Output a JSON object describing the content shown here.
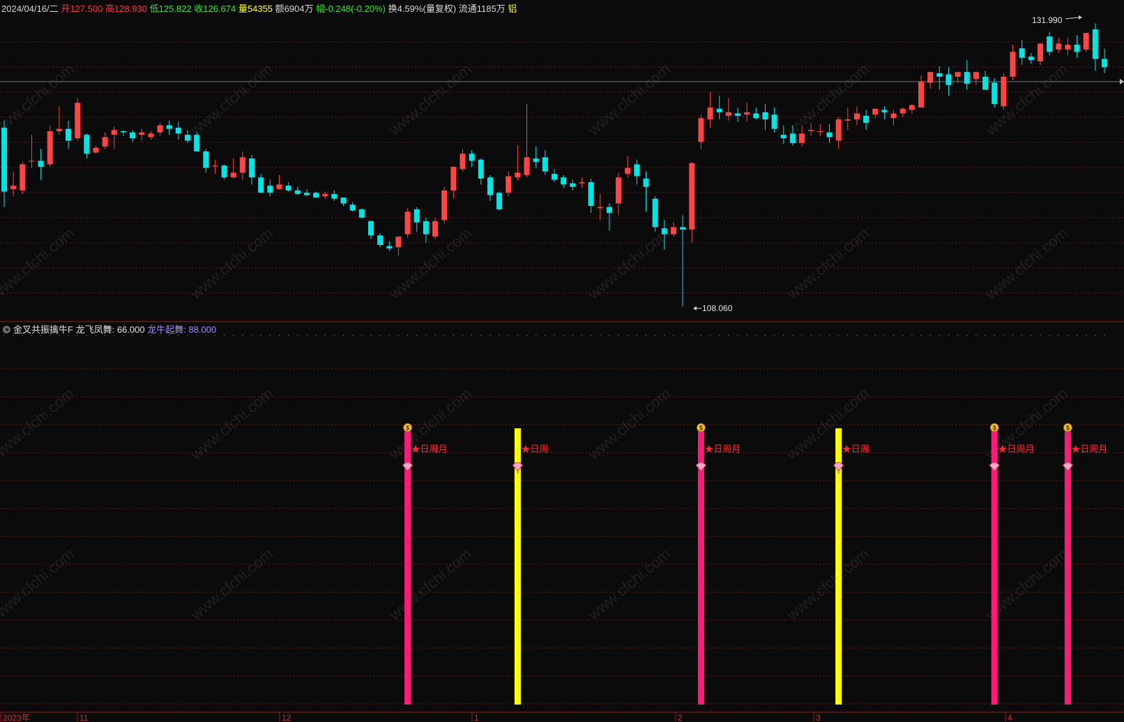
{
  "info_bar": {
    "date": "2024/04/16/二",
    "open": {
      "label": "开",
      "value": "127.500"
    },
    "high": {
      "label": "高",
      "value": "128.930"
    },
    "low": {
      "label": "低",
      "value": "125.822"
    },
    "close": {
      "label": "收",
      "value": "126.674"
    },
    "volume": {
      "label": "量",
      "value": "54355"
    },
    "amount": {
      "label": "额",
      "value": "6904万"
    },
    "change": {
      "label": "幅",
      "value": "-0.248(-0.20%)"
    },
    "turnover": {
      "label": "换",
      "value": "4.59%"
    },
    "adjust": "(量复权)",
    "float": {
      "label": "流通",
      "value": "1185万"
    },
    "sector": "铝"
  },
  "indicator_bar": {
    "name": "金叉共振擒牛F",
    "line1": {
      "label": "龙飞凤舞",
      "value": "66.000"
    },
    "line2": {
      "label": "龙牛起舞",
      "value": "88.000"
    }
  },
  "price_panel": {
    "high_marker": "131.990",
    "low_marker": "108.060",
    "ylim": [
      107.0,
      132.8
    ]
  },
  "time_axis": [
    "2023年",
    "11",
    "12",
    "1",
    "2",
    "3",
    "4"
  ],
  "watermark": "www.cfchi.com",
  "colors": {
    "up": "#ff4444",
    "down": "#00e5e5",
    "pink": "#ff1a7a",
    "yellow": "#ffff00",
    "bg": "#0b0b0b",
    "grid": "#6a1b1b",
    "signal_text": "#ff2a2a"
  },
  "chart_data": {
    "type": "candlestick",
    "series": [
      {
        "o": 123.2,
        "h": 123.8,
        "c": 117.8,
        "l": 116.5
      },
      {
        "o": 118.0,
        "h": 119.5,
        "c": 118.3,
        "l": 117.4
      },
      {
        "o": 117.9,
        "h": 120.3,
        "c": 120.1,
        "l": 117.6
      },
      {
        "o": 120.4,
        "h": 122.6,
        "c": 120.4,
        "l": 119.8
      },
      {
        "o": 120.4,
        "h": 121.4,
        "c": 119.9,
        "l": 118.8
      },
      {
        "o": 120.1,
        "h": 123.4,
        "c": 122.9,
        "l": 119.9
      },
      {
        "o": 122.9,
        "h": 125.0,
        "c": 123.1,
        "l": 122.6
      },
      {
        "o": 123.1,
        "h": 123.8,
        "c": 122.1,
        "l": 121.4
      },
      {
        "o": 122.3,
        "h": 125.7,
        "c": 125.3,
        "l": 122.1
      },
      {
        "o": 122.6,
        "h": 122.7,
        "c": 121.0,
        "l": 120.6
      },
      {
        "o": 121.1,
        "h": 121.7,
        "c": 121.5,
        "l": 121.0
      },
      {
        "o": 121.6,
        "h": 122.8,
        "c": 122.4,
        "l": 121.4
      },
      {
        "o": 122.6,
        "h": 123.3,
        "c": 123.0,
        "l": 121.4
      },
      {
        "o": 122.9,
        "h": 123.0,
        "c": 122.8,
        "l": 122.5
      },
      {
        "o": 122.8,
        "h": 123.0,
        "c": 122.3,
        "l": 122.0
      },
      {
        "o": 122.6,
        "h": 123.1,
        "c": 122.8,
        "l": 122.1
      },
      {
        "o": 122.4,
        "h": 122.9,
        "c": 122.7,
        "l": 122.2
      },
      {
        "o": 122.8,
        "h": 123.6,
        "c": 123.4,
        "l": 122.5
      },
      {
        "o": 123.4,
        "h": 123.8,
        "c": 123.1,
        "l": 122.6
      },
      {
        "o": 123.2,
        "h": 123.7,
        "c": 122.7,
        "l": 122.2
      },
      {
        "o": 122.6,
        "h": 123.0,
        "c": 122.1,
        "l": 121.9
      },
      {
        "o": 122.6,
        "h": 122.8,
        "c": 121.2,
        "l": 121.2
      },
      {
        "o": 121.2,
        "h": 121.4,
        "c": 119.8,
        "l": 119.4
      },
      {
        "o": 120.0,
        "h": 120.5,
        "c": 120.0,
        "l": 119.3
      },
      {
        "o": 120.0,
        "h": 120.1,
        "c": 119.0,
        "l": 118.8
      },
      {
        "o": 119.0,
        "h": 120.6,
        "c": 119.4,
        "l": 118.9
      },
      {
        "o": 119.4,
        "h": 121.2,
        "c": 120.7,
        "l": 118.8
      },
      {
        "o": 120.6,
        "h": 120.9,
        "c": 119.0,
        "l": 118.4
      },
      {
        "o": 119.0,
        "h": 119.3,
        "c": 117.7,
        "l": 117.7
      },
      {
        "o": 118.3,
        "h": 118.8,
        "c": 117.7,
        "l": 117.4
      },
      {
        "o": 118.0,
        "h": 119.2,
        "c": 118.4,
        "l": 118.0
      },
      {
        "o": 118.3,
        "h": 118.6,
        "c": 117.9,
        "l": 117.8
      },
      {
        "o": 117.9,
        "h": 118.2,
        "c": 117.6,
        "l": 117.5
      },
      {
        "o": 117.7,
        "h": 118.0,
        "c": 117.5,
        "l": 117.4
      },
      {
        "o": 117.7,
        "h": 117.8,
        "c": 117.3,
        "l": 117.3
      },
      {
        "o": 117.4,
        "h": 117.8,
        "c": 117.6,
        "l": 117.2
      },
      {
        "o": 117.6,
        "h": 117.9,
        "c": 117.2,
        "l": 117.0
      },
      {
        "o": 117.3,
        "h": 117.3,
        "c": 116.8,
        "l": 116.6
      },
      {
        "o": 116.7,
        "h": 116.9,
        "c": 116.2,
        "l": 116.1
      },
      {
        "o": 116.3,
        "h": 116.4,
        "c": 115.6,
        "l": 115.5
      },
      {
        "o": 115.3,
        "h": 115.4,
        "c": 114.1,
        "l": 113.8
      },
      {
        "o": 114.1,
        "h": 114.3,
        "c": 113.3,
        "l": 113.1
      },
      {
        "o": 113.2,
        "h": 113.6,
        "c": 113.0,
        "l": 112.8
      },
      {
        "o": 113.1,
        "h": 113.9,
        "c": 114.0,
        "l": 112.4
      },
      {
        "o": 114.2,
        "h": 116.4,
        "c": 116.1,
        "l": 113.9
      },
      {
        "o": 116.3,
        "h": 116.5,
        "c": 115.2,
        "l": 114.4
      },
      {
        "o": 115.3,
        "h": 115.6,
        "c": 114.2,
        "l": 113.5
      },
      {
        "o": 114.0,
        "h": 115.6,
        "c": 115.3,
        "l": 113.8
      },
      {
        "o": 115.4,
        "h": 118.2,
        "c": 117.9,
        "l": 115.1
      },
      {
        "o": 117.9,
        "h": 119.9,
        "c": 119.9,
        "l": 117.2
      },
      {
        "o": 119.7,
        "h": 121.4,
        "c": 121.0,
        "l": 119.5
      },
      {
        "o": 121.0,
        "h": 121.3,
        "c": 120.4,
        "l": 119.9
      },
      {
        "o": 120.5,
        "h": 120.6,
        "c": 118.9,
        "l": 118.4
      },
      {
        "o": 119.0,
        "h": 119.2,
        "c": 117.5,
        "l": 117.0
      },
      {
        "o": 117.7,
        "h": 117.8,
        "c": 116.3,
        "l": 116.2
      },
      {
        "o": 117.7,
        "h": 119.5,
        "c": 119.1,
        "l": 117.4
      },
      {
        "o": 119.0,
        "h": 121.7,
        "c": 119.4,
        "l": 118.7
      },
      {
        "o": 119.2,
        "h": 125.2,
        "c": 120.7,
        "l": 119.0
      },
      {
        "o": 120.6,
        "h": 121.6,
        "c": 120.3,
        "l": 119.8
      },
      {
        "o": 120.7,
        "h": 121.3,
        "c": 119.5,
        "l": 119.2
      },
      {
        "o": 119.3,
        "h": 119.7,
        "c": 118.8,
        "l": 118.6
      },
      {
        "o": 119.0,
        "h": 119.2,
        "c": 118.4,
        "l": 118.1
      },
      {
        "o": 118.5,
        "h": 118.8,
        "c": 118.2,
        "l": 117.9
      },
      {
        "o": 118.5,
        "h": 119.0,
        "c": 118.6,
        "l": 118.1
      },
      {
        "o": 118.6,
        "h": 118.9,
        "c": 116.6,
        "l": 116.0
      },
      {
        "o": 116.4,
        "h": 117.6,
        "c": 116.5,
        "l": 115.4
      },
      {
        "o": 116.5,
        "h": 116.8,
        "c": 116.0,
        "l": 114.5
      },
      {
        "o": 116.8,
        "h": 119.4,
        "c": 119.0,
        "l": 115.8
      },
      {
        "o": 119.3,
        "h": 120.8,
        "c": 119.8,
        "l": 119.0
      },
      {
        "o": 120.1,
        "h": 120.5,
        "c": 119.1,
        "l": 118.4
      },
      {
        "o": 118.9,
        "h": 119.5,
        "c": 118.2,
        "l": 116.1
      },
      {
        "o": 117.2,
        "h": 117.4,
        "c": 114.8,
        "l": 114.4
      },
      {
        "o": 114.7,
        "h": 115.4,
        "c": 114.2,
        "l": 112.9
      },
      {
        "o": 114.2,
        "h": 115.2,
        "c": 114.8,
        "l": 114.0
      },
      {
        "o": 114.8,
        "h": 115.8,
        "c": 114.6,
        "l": 108.1
      },
      {
        "o": 114.6,
        "h": 120.3,
        "c": 120.2,
        "l": 113.5
      },
      {
        "o": 122.0,
        "h": 124.3,
        "c": 124.0,
        "l": 121.4
      },
      {
        "o": 123.9,
        "h": 126.2,
        "c": 124.9,
        "l": 123.2
      },
      {
        "o": 124.8,
        "h": 125.9,
        "c": 124.5,
        "l": 123.9
      },
      {
        "o": 124.2,
        "h": 125.7,
        "c": 124.5,
        "l": 123.8
      },
      {
        "o": 124.4,
        "h": 124.9,
        "c": 124.2,
        "l": 123.7
      },
      {
        "o": 124.3,
        "h": 125.3,
        "c": 124.5,
        "l": 123.7
      },
      {
        "o": 124.4,
        "h": 124.9,
        "c": 124.0,
        "l": 123.9
      },
      {
        "o": 124.5,
        "h": 125.2,
        "c": 123.9,
        "l": 123.0
      },
      {
        "o": 124.3,
        "h": 124.9,
        "c": 123.1,
        "l": 122.8
      },
      {
        "o": 122.6,
        "h": 123.4,
        "c": 122.3,
        "l": 121.8
      },
      {
        "o": 122.7,
        "h": 123.4,
        "c": 121.9,
        "l": 121.7
      },
      {
        "o": 121.9,
        "h": 123.3,
        "c": 122.7,
        "l": 121.6
      },
      {
        "o": 122.9,
        "h": 123.6,
        "c": 123.0,
        "l": 122.5
      },
      {
        "o": 122.9,
        "h": 123.5,
        "c": 122.9,
        "l": 122.5
      },
      {
        "o": 122.8,
        "h": 123.5,
        "c": 122.4,
        "l": 121.9
      },
      {
        "o": 122.1,
        "h": 124.1,
        "c": 123.9,
        "l": 121.4
      },
      {
        "o": 123.8,
        "h": 124.9,
        "c": 123.9,
        "l": 123.0
      },
      {
        "o": 123.9,
        "h": 125.0,
        "c": 124.4,
        "l": 123.4
      },
      {
        "o": 124.2,
        "h": 124.7,
        "c": 123.6,
        "l": 123.0
      },
      {
        "o": 124.3,
        "h": 124.8,
        "c": 124.8,
        "l": 124.0
      },
      {
        "o": 124.7,
        "h": 125.0,
        "c": 124.5,
        "l": 123.9
      },
      {
        "o": 124.0,
        "h": 124.7,
        "c": 124.4,
        "l": 123.4
      },
      {
        "o": 124.4,
        "h": 124.9,
        "c": 124.8,
        "l": 124.1
      },
      {
        "o": 124.7,
        "h": 125.2,
        "c": 125.1,
        "l": 124.4
      },
      {
        "o": 124.9,
        "h": 127.6,
        "c": 127.1,
        "l": 124.9
      },
      {
        "o": 127.0,
        "h": 127.7,
        "c": 127.9,
        "l": 126.5
      },
      {
        "o": 127.8,
        "h": 128.4,
        "c": 127.5,
        "l": 126.4
      },
      {
        "o": 127.7,
        "h": 128.3,
        "c": 126.8,
        "l": 125.9
      },
      {
        "o": 127.5,
        "h": 127.8,
        "c": 127.9,
        "l": 127.0
      },
      {
        "o": 127.9,
        "h": 128.9,
        "c": 126.9,
        "l": 126.4
      },
      {
        "o": 127.3,
        "h": 127.9,
        "c": 127.9,
        "l": 126.8
      },
      {
        "o": 127.5,
        "h": 128.0,
        "c": 126.4,
        "l": 126.4
      },
      {
        "o": 127.0,
        "h": 127.4,
        "c": 125.2,
        "l": 124.9
      },
      {
        "o": 125.0,
        "h": 127.8,
        "c": 127.5,
        "l": 124.7
      },
      {
        "o": 127.5,
        "h": 130.2,
        "c": 129.6,
        "l": 127.2
      },
      {
        "o": 129.9,
        "h": 130.6,
        "c": 129.1,
        "l": 128.5
      },
      {
        "o": 129.2,
        "h": 129.5,
        "c": 128.9,
        "l": 128.6
      },
      {
        "o": 128.8,
        "h": 130.3,
        "c": 130.3,
        "l": 128.5
      },
      {
        "o": 130.9,
        "h": 131.3,
        "c": 129.6,
        "l": 129.3
      },
      {
        "o": 129.8,
        "h": 130.8,
        "c": 130.3,
        "l": 129.5
      },
      {
        "o": 129.8,
        "h": 130.8,
        "c": 130.2,
        "l": 129.3
      },
      {
        "o": 130.2,
        "h": 131.0,
        "c": 129.6,
        "l": 129.1
      },
      {
        "o": 129.8,
        "h": 131.2,
        "c": 131.2,
        "l": 129.6
      },
      {
        "o": 131.5,
        "h": 132.0,
        "c": 129.0,
        "l": 128.0
      },
      {
        "o": 129.0,
        "h": 129.9,
        "c": 128.3,
        "l": 127.8
      }
    ],
    "signals": [
      {
        "bar": 44,
        "color": "pink",
        "label": "★日周月",
        "top_icon": "money-bag"
      },
      {
        "bar": 56,
        "color": "yellow",
        "label": "★日周"
      },
      {
        "bar": 76,
        "color": "pink",
        "label": "★日周月",
        "top_icon": "money-bag"
      },
      {
        "bar": 91,
        "color": "yellow",
        "label": "★日周"
      },
      {
        "bar": 108,
        "color": "pink",
        "label": "★日周月",
        "top_icon": "money-bag"
      },
      {
        "bar": 116,
        "color": "pink",
        "label": "★日周月",
        "top_icon": "money-bag"
      }
    ]
  }
}
